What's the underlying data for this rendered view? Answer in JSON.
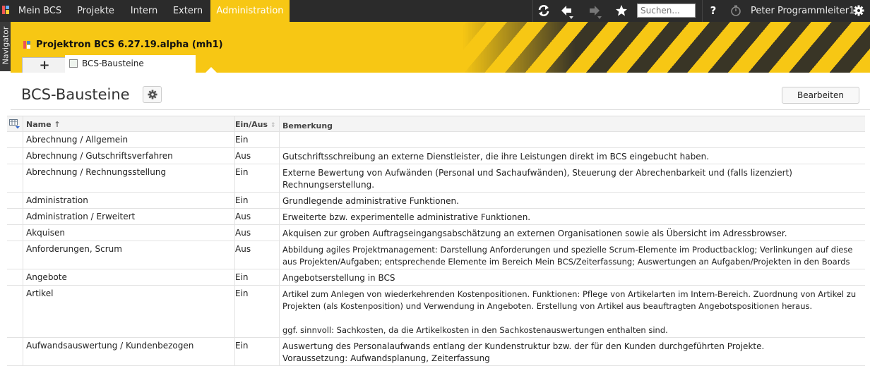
{
  "topbar": {
    "nav": [
      {
        "label": "Mein BCS",
        "active": false
      },
      {
        "label": "Projekte",
        "active": false
      },
      {
        "label": "Intern",
        "active": false
      },
      {
        "label": "Extern",
        "active": false
      },
      {
        "label": "Administration",
        "active": true
      }
    ],
    "icons": [
      "refresh-icon",
      "back-arrow-icon",
      "forward-arrow-icon",
      "star-icon",
      "help-icon",
      "timer-icon",
      "gear-icon"
    ],
    "search_placeholder": "Suchen...",
    "help_label": "?",
    "user_name": "Peter Programmleiter1"
  },
  "navigator": {
    "label": "Navigator"
  },
  "header": {
    "app_title": "Projektron BCS 6.27.19.alpha (mh1)",
    "add_tab_label": "+",
    "active_tab_label": "BCS-Bausteine",
    "accent_color": "#f7c714"
  },
  "page": {
    "title": "BCS-Bausteine",
    "edit_button": "Bearbeiten"
  },
  "table": {
    "columns": {
      "name": "Name",
      "status": "Ein/Aus",
      "remark": "Bemerkung"
    },
    "rows": [
      {
        "name": "Abrechnung / Allgemein",
        "status": "Ein",
        "remark": ""
      },
      {
        "name": "Abrechnung / Gutschriftsverfahren",
        "status": "Aus",
        "remark": "Gutschriftsschreibung an externe Dienstleister, die ihre Leistungen direkt im BCS eingebucht haben."
      },
      {
        "name": "Abrechnung / Rechnungsstellung",
        "status": "Ein",
        "remark": "Externe Bewertung von Aufwänden (Personal und Sachaufwänden), Steuerung der Abrechenbarkeit und (falls lizenziert)\nRechnungserstellung."
      },
      {
        "name": "Administration",
        "status": "Ein",
        "remark": "Grundlegende administrative Funktionen."
      },
      {
        "name": "Administration / Erweitert",
        "status": "Aus",
        "remark": "Erweiterte bzw. experimentelle administrative Funktionen."
      },
      {
        "name": "Akquisen",
        "status": "Aus",
        "remark": "Akquisen zur groben Auftragseingangsabschätzung an externen Organisationen sowie als Übersicht im Adressbrowser."
      },
      {
        "name": "Anforderungen, Scrum",
        "status": "Aus",
        "remark": "Abbildung agiles Projektmanagement: Darstellung Anforderungen und spezielle Scrum-Elemente im Productbacklog; Verlinkungen auf diese\naus Projekten/Aufgaben; entsprechende Elemente im Bereich Mein BCS/Zeiterfassung; Auswertungen an Aufgaben/Projekten in den Boards"
      },
      {
        "name": "Angebote",
        "status": "Ein",
        "remark": "Angebotserstellung in BCS"
      },
      {
        "name": "Artikel",
        "status": "Ein",
        "remark": "Artikel zum Anlegen von wiederkehrenden Kostenpositionen. Funktionen: Pflege von Artikelarten im Intern-Bereich. Zuordnung von Artikel zu\nProjekten (als Kostenposition) und Verwendung in Angeboten. Erstellung von Artikel aus beauftragten Angebotspositionen heraus.\n\nggf. sinnvoll: Sachkosten, da die Artikelkosten in den Sachkostenauswertungen enthalten sind."
      },
      {
        "name": "Aufwandsauswertung / Kundenbezogen",
        "status": "Ein",
        "remark": "Auswertung des Personalaufwands entlang der Kundenstruktur bzw. der für den Kunden durchgeführten Projekte.\nVoraussetzung: Aufwandsplanung, Zeiterfassung"
      }
    ]
  }
}
